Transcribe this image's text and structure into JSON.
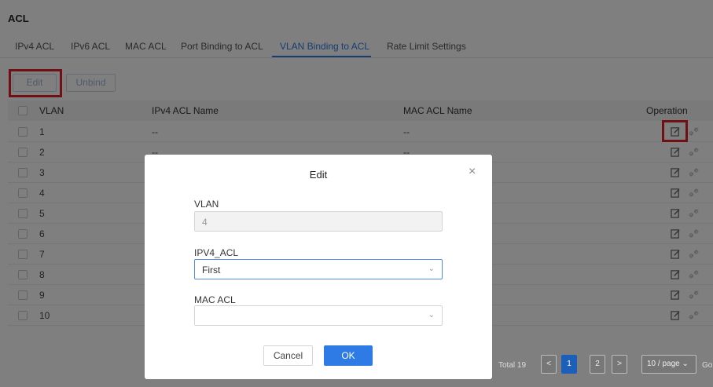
{
  "page": {
    "title": "ACL"
  },
  "tabs": [
    {
      "label": "IPv4 ACL",
      "active": false
    },
    {
      "label": "IPv6 ACL",
      "active": false
    },
    {
      "label": "MAC ACL",
      "active": false
    },
    {
      "label": "Port Binding to ACL",
      "active": false
    },
    {
      "label": "VLAN Binding to ACL",
      "active": true
    },
    {
      "label": "Rate Limit Settings",
      "active": false
    }
  ],
  "toolbar": {
    "edit_label": "Edit",
    "unbind_label": "Unbind"
  },
  "table": {
    "columns": {
      "vlan": "VLAN",
      "ipv4": "IPv4 ACL Name",
      "mac": "MAC ACL Name",
      "operation": "Operation"
    },
    "rows": [
      {
        "vlan": "1",
        "ipv4": "--",
        "mac": "--"
      },
      {
        "vlan": "2",
        "ipv4": "--",
        "mac": "--"
      },
      {
        "vlan": "3",
        "ipv4": "",
        "mac": ""
      },
      {
        "vlan": "4",
        "ipv4": "",
        "mac": ""
      },
      {
        "vlan": "5",
        "ipv4": "",
        "mac": ""
      },
      {
        "vlan": "6",
        "ipv4": "",
        "mac": ""
      },
      {
        "vlan": "7",
        "ipv4": "",
        "mac": ""
      },
      {
        "vlan": "8",
        "ipv4": "",
        "mac": ""
      },
      {
        "vlan": "9",
        "ipv4": "",
        "mac": ""
      },
      {
        "vlan": "10",
        "ipv4": "",
        "mac": ""
      }
    ],
    "operation_icons": [
      "edit-icon",
      "link-icon"
    ]
  },
  "pagination": {
    "total": "Total 19",
    "prev": "<",
    "pages": [
      "1",
      "2"
    ],
    "next": ">",
    "page_size": "10 / page",
    "go": "Go"
  },
  "modal": {
    "title": "Edit",
    "close": "×",
    "vlan_label": "VLAN",
    "vlan_value": "4",
    "ipv4_label": "IPV4_ACL",
    "ipv4_value": "First",
    "mac_label": "MAC ACL",
    "mac_value": "",
    "cancel_label": "Cancel",
    "ok_label": "OK"
  },
  "colors": {
    "accent": "#2e7be6",
    "highlight": "#e0202a"
  }
}
